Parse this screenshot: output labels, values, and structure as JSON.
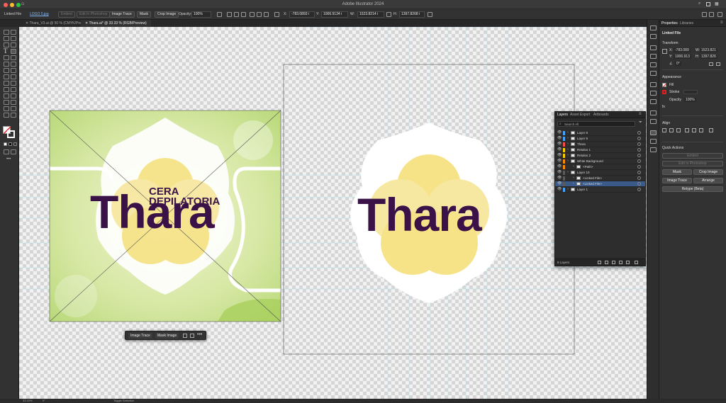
{
  "titlebar": {
    "title": "Adobe Illustrator 2024"
  },
  "control_bar": {
    "context_label": "Linked File",
    "file_name": "LOGO 5.jpg",
    "embed_label": "Embed",
    "edit_original_label": "Edit In Photoshop",
    "image_trace_label": "Image Trace",
    "mask_label": "Mask",
    "crop_image_label": "Crop Image",
    "opacity_label": "Opacity:",
    "opacity_value": "100%",
    "x_label": "X:",
    "x_value": "-783.0893 i",
    "y_label": "Y:",
    "y_value": "1006.9134 i",
    "w_label": "W:",
    "w_value": "1523.8214 i",
    "h_label": "H:",
    "h_value": "1397.8268 i"
  },
  "doc_tabs": [
    {
      "label": "Thara_V3.ai @ 50 % (CMYK/Preview)"
    },
    {
      "label": "Thara.ai* @ 33.33 % (RGB/Preview)"
    }
  ],
  "artwork": {
    "brand": "Thara",
    "tagline_1": "CERA",
    "tagline_2": "DEPILATORIA",
    "brand_color": "#3a1248",
    "petal_color": "#f4dc6a"
  },
  "context_toolbar": {
    "image_trace_label": "Image Trace",
    "mask_image_label": "Mask Image"
  },
  "layers_panel": {
    "tabs": [
      "Layers",
      "Asset Export",
      "Artboards"
    ],
    "search_placeholder": "Search All",
    "rows": [
      {
        "name": "Layer 8",
        "color": "#4aa3ff"
      },
      {
        "name": "Layer 9",
        "color": "#4aa3ff"
      },
      {
        "name": "Thara",
        "color": "#ff4a4a"
      },
      {
        "name": "Retalos 1",
        "color": "#ffcc00"
      },
      {
        "name": "Retalos 2",
        "color": "#ffcc00"
      },
      {
        "name": "White Background",
        "color": "#ff8a00"
      },
      {
        "name": "<Path>",
        "color": "#ff8a00"
      },
      {
        "name": "Layer 10",
        "color": "#5a5a5a"
      },
      {
        "name": "<Linked File>",
        "color": "#5a5a5a"
      },
      {
        "name": "<Linked File>",
        "color": "#5a5a5a"
      },
      {
        "name": "Layer 1",
        "color": "#4aa3ff"
      }
    ],
    "footer_count": "8 Layers"
  },
  "properties_panel": {
    "tabs": [
      "Properties",
      "Libraries"
    ],
    "section_title": "Linked File",
    "transform_label": "Transform",
    "x_label": "X:",
    "x_value": "-783.089",
    "y_label": "Y:",
    "y_value": "1006.913",
    "w_label": "W:",
    "w_value": "1523.821",
    "h_label": "H:",
    "h_value": "1397.826",
    "angle_value": "0°",
    "appearance_label": "Appearance",
    "fill_label": "Fill",
    "stroke_label": "Stroke",
    "opacity_label": "Opacity",
    "opacity_value": "100%",
    "align_label": "Align",
    "quick_actions_label": "Quick Actions",
    "embed_label": "Embed",
    "edit_photoshop_label": "Edit In Photoshop",
    "mask_label": "Mask",
    "crop_image_label": "Crop Image",
    "image_trace_label": "Image Trace",
    "arrange_label": "Arrange",
    "retype_label": "Retype (Beta)"
  },
  "statusbar": {
    "zoom": "33.33%",
    "angle": "0°",
    "mode": "Toggle Selection"
  }
}
